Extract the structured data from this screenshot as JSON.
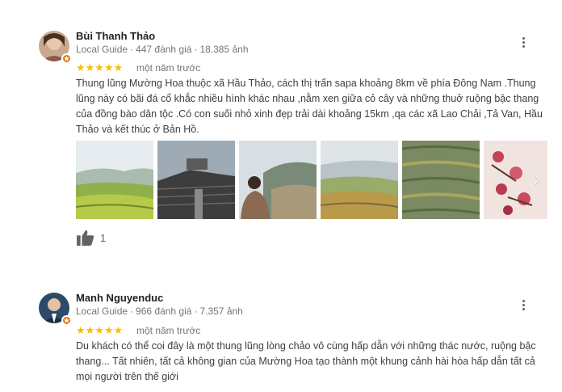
{
  "reviews": [
    {
      "author": "Bùi Thanh Thảo",
      "guide_label": "Local Guide",
      "review_count": "447 đánh giá",
      "photo_count": "18.385 ảnh",
      "rating": "★★★★★",
      "time": "một năm trước",
      "text_lines": [
        "Thung lũng Mường Hoa thuộc xã Hầu Thảo, cách thị trấn sapa khoảng 8km về phía Đông Nam .Thung",
        "lũng này có bãi đá cổ khắc nhiều hình khác nhau ,nằm xen giữa cỏ cây và những thuở ruộng bậc thang",
        "của đồng bào dân tộc .Có con suối nhỏ xinh đẹp trải dài khoảng 15km ,qa các xã Lao Chải ,Tả Van, Hầu",
        "Thảo và kết thúc ở Bản Hồ."
      ],
      "photos": [
        "valley-terraces",
        "stone-building",
        "person-on-hill",
        "misty-valley",
        "rice-terraces",
        "pink-flowers"
      ],
      "like_count": "1",
      "icons": {
        "more": "more-vert-icon",
        "like": "thumb-up-icon",
        "next": "chevron-right-icon",
        "badge": "local-guide-badge-icon"
      }
    },
    {
      "author": "Manh Nguyenduc",
      "guide_label": "Local Guide",
      "review_count": "966 đánh giá",
      "photo_count": "7.357 ảnh",
      "rating": "★★★★★",
      "time": "một năm trước",
      "text_lines": [
        "Du khách có thể coi đây là một thung lũng lòng chảo vô cùng hấp dẫn với những thác nước, ruộng bậc",
        "thang... Tất nhiên, tất cả không gian của Mường Hoa tạo thành một khung cảnh hài hòa hấp dẫn tất cả",
        "mọi người trên thế giới"
      ],
      "icons": {
        "more": "more-vert-icon",
        "badge": "local-guide-badge-icon"
      }
    }
  ],
  "colors": {
    "star": "#fbbc04",
    "badge": "#e8710a",
    "meta": "#70757a"
  },
  "separator": "·"
}
